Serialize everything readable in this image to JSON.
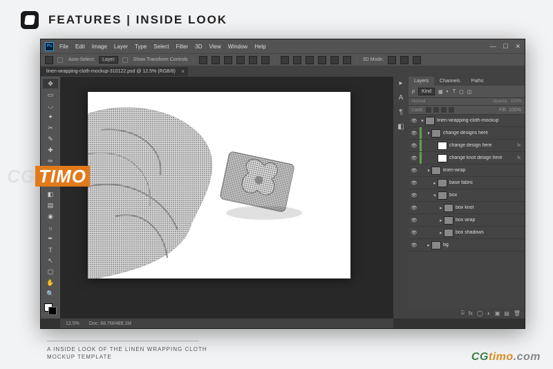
{
  "banner": {
    "prefix": "FEATURES | ",
    "bold": "INSIDE LOOK"
  },
  "menubar": {
    "ps": "Ps",
    "items": [
      "File",
      "Edit",
      "Image",
      "Layer",
      "Type",
      "Select",
      "Filter",
      "3D",
      "View",
      "Window",
      "Help"
    ]
  },
  "optbar": {
    "auto_select": "Auto-Select:",
    "layer": "Layer",
    "show_tc": "Show Transform Controls",
    "d3": "3D Mode:"
  },
  "doctab": {
    "title": "linen-wrapping-cloth-mockup-310122.psd @ 12.5% (RGB/8)"
  },
  "rstrip": {
    "a": "A"
  },
  "layers": {
    "tabs": [
      "Layers",
      "Channels",
      "Paths"
    ],
    "kind": "Kind",
    "mode": "Normal",
    "opacity_lbl": "Opacity:",
    "opacity": "100%",
    "lock_lbl": "Lock:",
    "fill_lbl": "Fill:",
    "fill": "100%",
    "tree": [
      {
        "name": "linen-wrapping-cloth-mockup",
        "depth": 0,
        "arrow": "▾",
        "thumb": "folder",
        "vis": true
      },
      {
        "name": "change designs here",
        "depth": 1,
        "arrow": "▾",
        "thumb": "folder",
        "vis": true,
        "green": true
      },
      {
        "name": "change design here",
        "depth": 2,
        "thumb": "smart",
        "vis": true,
        "green": true,
        "fx": "fx"
      },
      {
        "name": "change knot design here",
        "depth": 2,
        "thumb": "smart",
        "vis": true,
        "green": true,
        "fx": "fx"
      },
      {
        "name": "linen-wrap",
        "depth": 1,
        "arrow": "▾",
        "thumb": "folder",
        "vis": true
      },
      {
        "name": "base fabric",
        "depth": 2,
        "arrow": "▸",
        "thumb": "folder",
        "vis": true
      },
      {
        "name": "box",
        "depth": 2,
        "arrow": "▾",
        "thumb": "folder",
        "vis": true
      },
      {
        "name": "box knot",
        "depth": 3,
        "arrow": "▸",
        "thumb": "folder",
        "vis": true
      },
      {
        "name": "box wrap",
        "depth": 3,
        "arrow": "▸",
        "thumb": "folder",
        "vis": true
      },
      {
        "name": "box shadows",
        "depth": 3,
        "arrow": "▸",
        "thumb": "folder",
        "vis": true
      },
      {
        "name": "bg",
        "depth": 1,
        "arrow": "▸",
        "thumb": "folder",
        "vis": true
      }
    ]
  },
  "status": {
    "zoom": "12.5%",
    "doc": "Doc: 68.7M/489.1M"
  },
  "caption": {
    "l1": "A INSIDE LOOK OF THE LINEN WRAPPING CLOTH",
    "l2": "MOCKUP TEMPLATE"
  },
  "wm": {
    "cg": "CG",
    "timo": "TIMO",
    "com": ".com",
    "cg2": "CG",
    "timo2": "timo"
  }
}
